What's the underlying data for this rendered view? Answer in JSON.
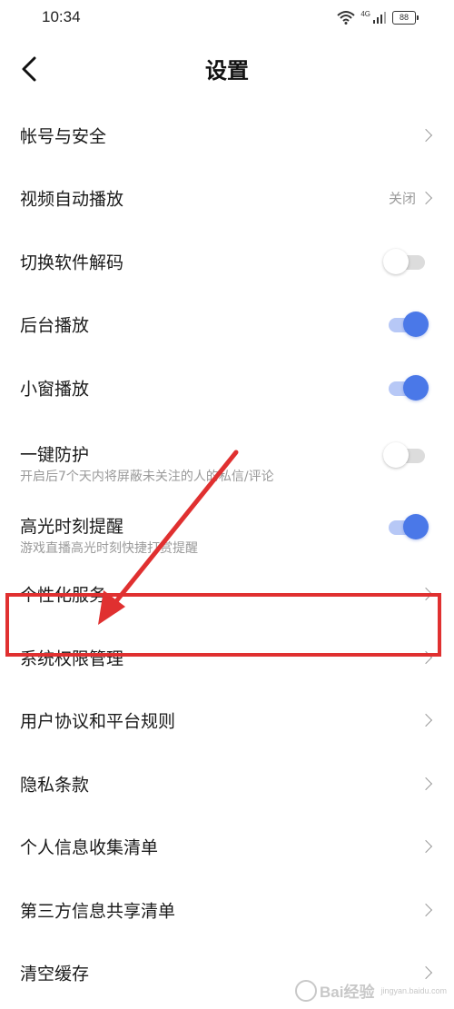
{
  "status_bar": {
    "time": "10:34",
    "network": "4G",
    "battery": "88"
  },
  "header": {
    "title": "设置"
  },
  "settings": {
    "rows": [
      {
        "label": "帐号与安全",
        "control": "chevron"
      },
      {
        "label": "视频自动播放",
        "control": "value-chevron",
        "value": "关闭"
      },
      {
        "label": "切换软件解码",
        "control": "toggle",
        "on": false
      },
      {
        "label": "后台播放",
        "control": "toggle",
        "on": true
      },
      {
        "label": "小窗播放",
        "control": "toggle",
        "on": true
      },
      {
        "label": "一键防护",
        "sub": "开启后7个天内将屏蔽未关注的人的私信/评论",
        "control": "toggle",
        "on": false
      },
      {
        "label": "高光时刻提醒",
        "sub": "游戏直播高光时刻快捷打赏提醒",
        "control": "toggle",
        "on": true
      },
      {
        "label": "个性化服务",
        "control": "chevron",
        "highlighted": true
      },
      {
        "label": "系统权限管理",
        "control": "chevron"
      },
      {
        "label": "用户协议和平台规则",
        "control": "chevron"
      },
      {
        "label": "隐私条款",
        "control": "chevron"
      },
      {
        "label": "个人信息收集清单",
        "control": "chevron"
      },
      {
        "label": "第三方信息共享清单",
        "control": "chevron"
      },
      {
        "label": "清空缓存",
        "control": "chevron"
      }
    ]
  },
  "colors": {
    "toggle_on": "#4a78e8",
    "toggle_on_track": "#b7c8f6",
    "toggle_off_track": "#dcdcdc",
    "annotation": "#e03030",
    "secondary_text": "#9a9a9a"
  },
  "watermark": {
    "text": "Bai经验",
    "sub": "jingyan.baidu.com"
  }
}
